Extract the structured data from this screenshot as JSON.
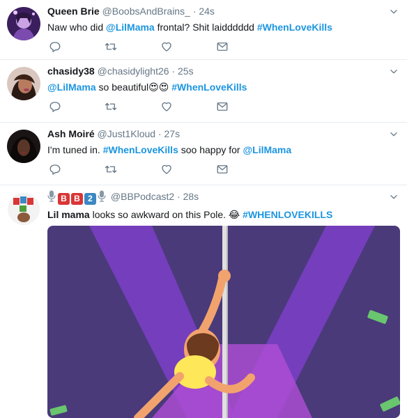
{
  "tweets": [
    {
      "name": "Queen Brie",
      "handle": "@BoobsAndBrains_",
      "sep": "·",
      "time": "24s",
      "text_a": "Naw who did ",
      "mention": "@LilMama",
      "text_b": " frontal? Shit laidddddd ",
      "hashtag": "#WhenLoveKills"
    },
    {
      "name": "chasidy38",
      "handle": "@chasidylight26",
      "sep": "·",
      "time": "25s",
      "mention": "@LilMama",
      "text_a": " so beautiful",
      "emoji": "😍😍",
      "text_b": " ",
      "hashtag": "#WhenLoveKills"
    },
    {
      "name": "Ash Moiré",
      "handle": "@Just1Kloud",
      "sep": "·",
      "time": "27s",
      "text_a": "I'm tuned in. ",
      "hashtag": "#WhenLoveKills",
      "text_b": " soo happy for ",
      "mention": "@LilMama"
    },
    {
      "name_badges": [
        "B",
        "B",
        "2"
      ],
      "handle": "@BBPodcast2",
      "sep": "·",
      "time": "28s",
      "text_a": "Lil mama",
      "text_b": " looks so awkward on this Pole. ",
      "emoji": "😂",
      "hashtag": "#WHENLOVEKILLS"
    }
  ],
  "icons": {
    "reply": "reply-icon",
    "retweet": "retweet-icon",
    "like": "heart-icon",
    "dm": "envelope-icon",
    "caret": "chevron-down-icon"
  },
  "colors": {
    "link": "#1b95e0",
    "icon": "#657786",
    "divider": "#e6ecf0",
    "gif_bg": "#4a3a7a",
    "spotlight": "#8a46c9",
    "pole": "#e0e0e0"
  }
}
